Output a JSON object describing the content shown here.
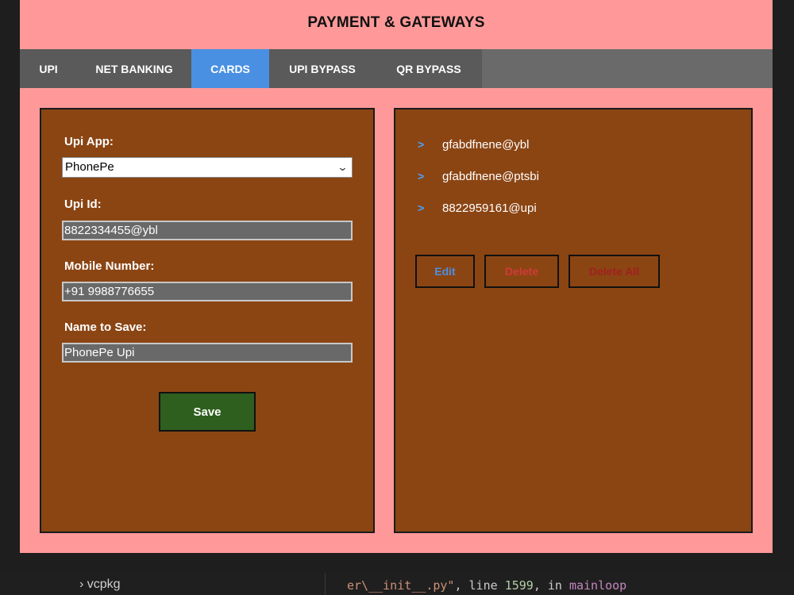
{
  "app": {
    "title": "PAYMENT & GATEWAYS",
    "tabs": [
      {
        "label": "UPI",
        "active": false
      },
      {
        "label": "NET BANKING",
        "active": false
      },
      {
        "label": "CARDS",
        "active": true
      },
      {
        "label": "UPI BYPASS",
        "active": false
      },
      {
        "label": "QR BYPASS",
        "active": false
      }
    ]
  },
  "form": {
    "upi_app_label": "Upi App:",
    "upi_app_value": "PhonePe",
    "upi_id_label": "Upi Id:",
    "upi_id_value": "8822334455@ybl",
    "mobile_label": "Mobile Number:",
    "mobile_value": "+91 9988776655",
    "name_label": "Name to Save:",
    "name_value": "PhonePe Upi",
    "save_label": "Save"
  },
  "saved_list": {
    "items": [
      "gfabdfnene@ybl",
      "gfabdfnene@ptsbi",
      "8822959161@upi"
    ],
    "edit_label": "Edit",
    "delete_label": "Delete",
    "delete_all_label": "Delete All"
  },
  "ide": {
    "folder_label": "vcpkg",
    "trace_file": "er\\__init__.py\"",
    "trace_line_word": ", line ",
    "trace_line_number": "1599",
    "trace_in": ", in ",
    "trace_function": "mainloop"
  },
  "colors": {
    "header_bg": "#ff9999",
    "tab_bar_bg": "#5a5a5a",
    "tab_active_bg": "#4a90e2",
    "panel_bg": "#8b4513",
    "save_bg": "#2e5f1e",
    "edit_text": "#4a90e2",
    "delete_text": "#d13a3a"
  },
  "icons": {
    "list_bullet": "chevron-right-icon",
    "select_toggle": "chevron-down-icon",
    "folder_toggle": "chevron-right-icon"
  }
}
